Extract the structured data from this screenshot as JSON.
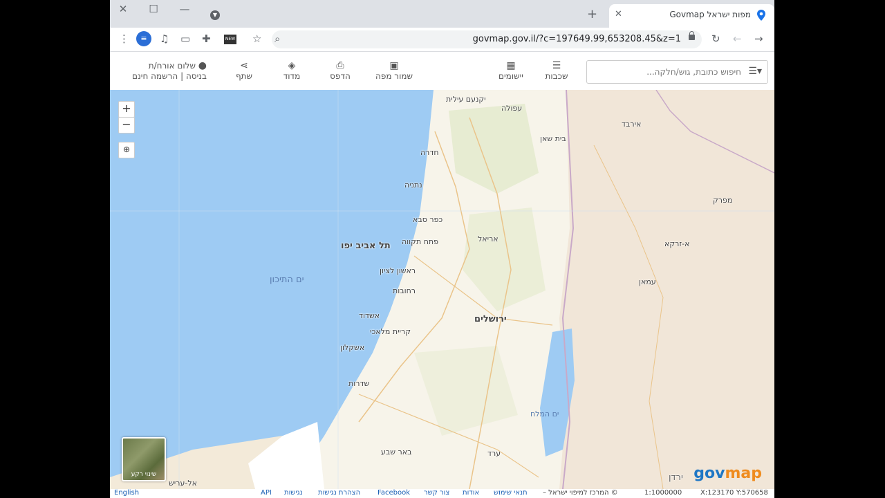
{
  "browser": {
    "tab_title": "מפות ישראל Govmap",
    "new_tab": "+",
    "url": "govmap.gov.il/?c=197649.99,653208.45&z=1"
  },
  "header": {
    "search_placeholder": "חיפוש כתובת, גוש/חלקה...",
    "layers": "שכבות",
    "apps": "יישומים",
    "save_map": "שמור מפה",
    "print": "הדפס",
    "measure": "מדוד",
    "share": "שתף",
    "greeting": "שלום אורח/ת",
    "login": "בניסה",
    "separator": "|",
    "register": "הרשמה חינם"
  },
  "map": {
    "zoom_in": "+",
    "zoom_out": "−",
    "basemap_label": "שינוי רקע",
    "logo_gov": "gov",
    "logo_map": "map",
    "places": {
      "yokneam": "יקנעם עילית",
      "afula": "עפולה",
      "beit_shean": "בית שאן",
      "irbid": "אירבד",
      "hadera": "חדרה",
      "netanya": "נתניה",
      "mafraq": "מפרק",
      "kfar_saba": "כפר סבא",
      "petah_tikva": "פתח תקווה",
      "ariel": "אריאל",
      "tel_aviv": "תל אביב יפו",
      "zarqa": "א-זרקא",
      "rishon": "ראשון לציון",
      "sea": "ים התיכון",
      "amman": "עמאן",
      "rehovot": "רחובות",
      "ashdod": "אשדוד",
      "jerusalem": "ירושלים",
      "kiryat_malachi": "קריית מלאכי",
      "ashkelon": "אשקלון",
      "sderot": "שדרות",
      "dead_sea": "ים המלח",
      "beer_sheva": "באר שבע",
      "arad": "ערד",
      "al_arish": "אל-עריש",
      "jordan": "ירדן"
    }
  },
  "footer": {
    "english": "English",
    "api": "API",
    "accessibility": "נגישות",
    "accessibility_statement": "הצהרת נגישות",
    "facebook": "Facebook",
    "contact": "צור קשר",
    "about": "אודות",
    "terms": "תנאי שימוש",
    "copyright": "© המרכז למיפוי ישראל –",
    "scale": "1:1000000",
    "coords": "X:123170 Y:570658"
  }
}
